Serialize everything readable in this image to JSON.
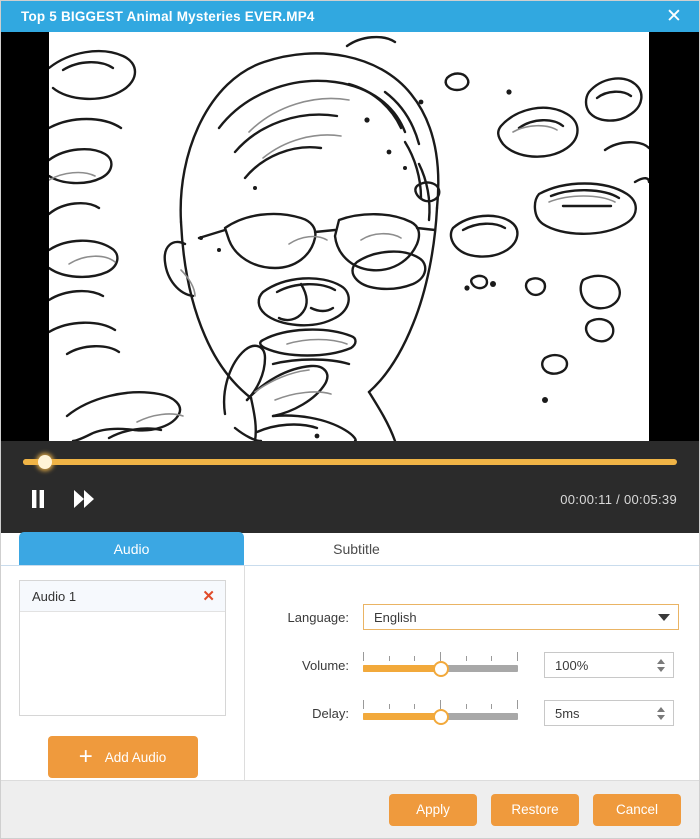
{
  "window": {
    "title": "Top 5 BIGGEST Animal Mysteries EVER.MP4",
    "close_icon": "close-icon",
    "accent_blue": "#31a8e0",
    "accent_orange": "#ef9a3d"
  },
  "player": {
    "pause_icon": "pause-icon",
    "forward_icon": "fast-forward-icon",
    "current_time": "00:00:11",
    "separator": "/",
    "total_time": "00:05:39",
    "time_display": "00:00:11 / 00:05:39",
    "progress_percent": 3.3,
    "track_color": "#f0b446"
  },
  "tabs": [
    {
      "label": "Audio",
      "active": true
    },
    {
      "label": "Subtitle",
      "active": false
    }
  ],
  "audio_panel": {
    "items": [
      {
        "label": "Audio 1",
        "remove_icon": "remove-icon"
      }
    ],
    "add_button": {
      "label": "Add Audio",
      "icon": "plus-icon"
    }
  },
  "settings": {
    "language": {
      "label": "Language:",
      "value": "English",
      "chevron_icon": "chevron-down-icon"
    },
    "volume": {
      "label": "Volume:",
      "slider_percent": 50,
      "value": "100%"
    },
    "delay": {
      "label": "Delay:",
      "slider_percent": 50,
      "value": "5ms"
    }
  },
  "footer": {
    "apply_label": "Apply",
    "restore_label": "Restore",
    "cancel_label": "Cancel"
  }
}
